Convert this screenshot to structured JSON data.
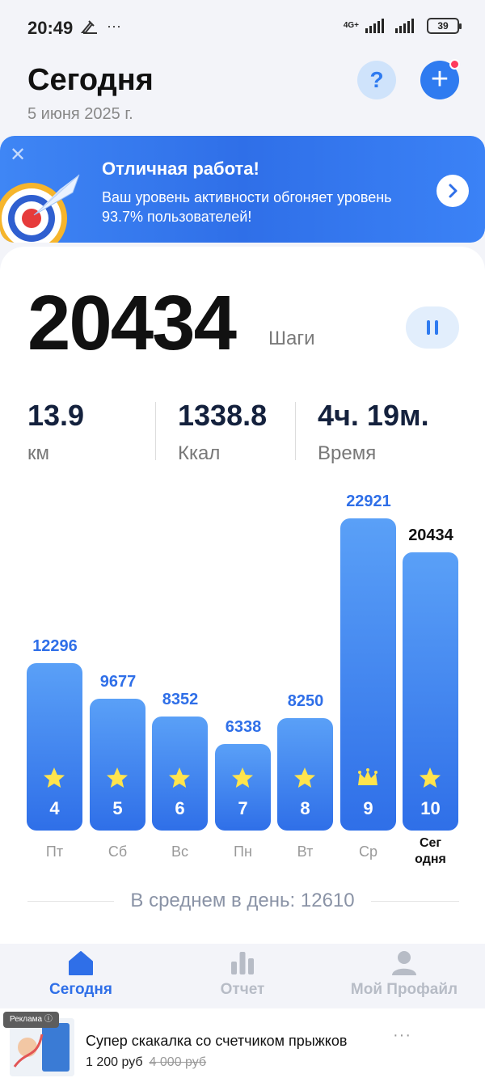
{
  "status_bar": {
    "time": "20:49",
    "network": "4G+",
    "battery": "39"
  },
  "header": {
    "title": "Сегодня",
    "date": "5 июня 2025 г.",
    "help_label": "?",
    "add_label": "+"
  },
  "banner": {
    "title": "Отличная работа!",
    "text": "Ваш уровень активности обгоняет уровень 93.7% пользователей!"
  },
  "summary": {
    "steps": "20434",
    "steps_unit": "Шаги",
    "stats": [
      {
        "value": "13.9",
        "label": "км"
      },
      {
        "value": "1338.8",
        "label": "Ккал"
      },
      {
        "value": "4ч. 19м.",
        "label": "Время"
      }
    ]
  },
  "chart_data": {
    "type": "bar",
    "categories": [
      "Пт",
      "Сб",
      "Вс",
      "Пн",
      "Вт",
      "Ср",
      "Сег\nодня"
    ],
    "day_numbers": [
      "4",
      "5",
      "6",
      "7",
      "8",
      "9",
      "10"
    ],
    "values": [
      12296,
      9677,
      8352,
      6338,
      8250,
      22921,
      20434
    ],
    "value_labels": [
      "12296",
      "9677",
      "8352",
      "6338",
      "8250",
      "22921",
      "20434"
    ],
    "icons": [
      "star-icon",
      "star-icon",
      "star-icon",
      "star-icon",
      "star-icon",
      "crown-icon",
      "star-icon"
    ],
    "today_index": 6,
    "colors": {
      "bar_top": "#5aa0f7",
      "bar_bottom": "#2f6fe8",
      "icon": "#ffe44d"
    }
  },
  "average": {
    "text": "В среднем в день: 12610"
  },
  "nav": {
    "items": [
      {
        "label": "Сегодня",
        "icon": "home-icon",
        "active": true
      },
      {
        "label": "Отчет",
        "icon": "bar-chart-icon",
        "active": false
      },
      {
        "label": "Мой Профайл",
        "icon": "user-icon",
        "active": false
      }
    ]
  },
  "ad": {
    "badge": "Реклама ⓘ",
    "title": "Супер скакалка со счетчиком прыжков",
    "price": "1 200 руб",
    "old_price": "4 000 руб",
    "more": "···"
  },
  "colors": {
    "accent": "#2f7bf0",
    "background": "#f3f4f9",
    "notification": "#ff3b5c"
  }
}
